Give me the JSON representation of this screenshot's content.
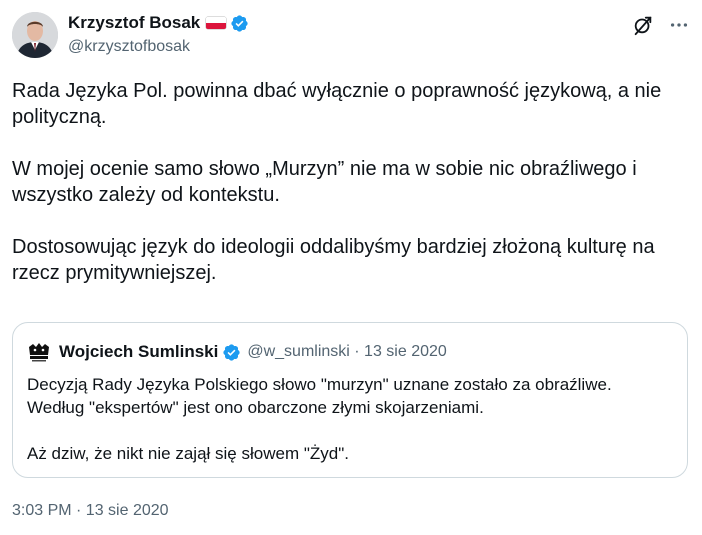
{
  "author": {
    "name": "Krzysztof Bosak",
    "handle": "@krzysztofbosak",
    "flag": "poland-flag",
    "verified_icon": "verified-badge-icon",
    "verified_color": "#1d9bf0"
  },
  "top_actions": [
    "grok-icon",
    "more-icon"
  ],
  "tweet": {
    "paragraphs": [
      "Rada Języka Pol. powinna dbać wyłącznie o poprawność językową, a nie polityczną.",
      "W mojej ocenie samo słowo „Murzyn” nie ma w sobie nic obraźliwego i wszystko zależy od kontekstu.",
      "Dostosowując język do ideologii oddalibyśmy bardziej złożoną kulturę na rzecz prymitywniejszej."
    ],
    "timestamp": "3:03 PM · 13 sie 2020"
  },
  "quote": {
    "name": "Wojciech Sumlinski",
    "handle_date": "@w_sumlinski · 13 sie 2020",
    "lines": [
      "Decyzją Rady Języka Polskiego słowo \"murzyn\" uznane zostało za obraźliwe.",
      "Według \"ekspertów\" jest ono obarczone złymi skojarzeniami.",
      "Aż dziw, że nikt nie zajął się słowem \"Żyd\"."
    ]
  },
  "colors": {
    "text": "#0f1419",
    "secondary": "#536471",
    "border": "#cfd9de"
  }
}
